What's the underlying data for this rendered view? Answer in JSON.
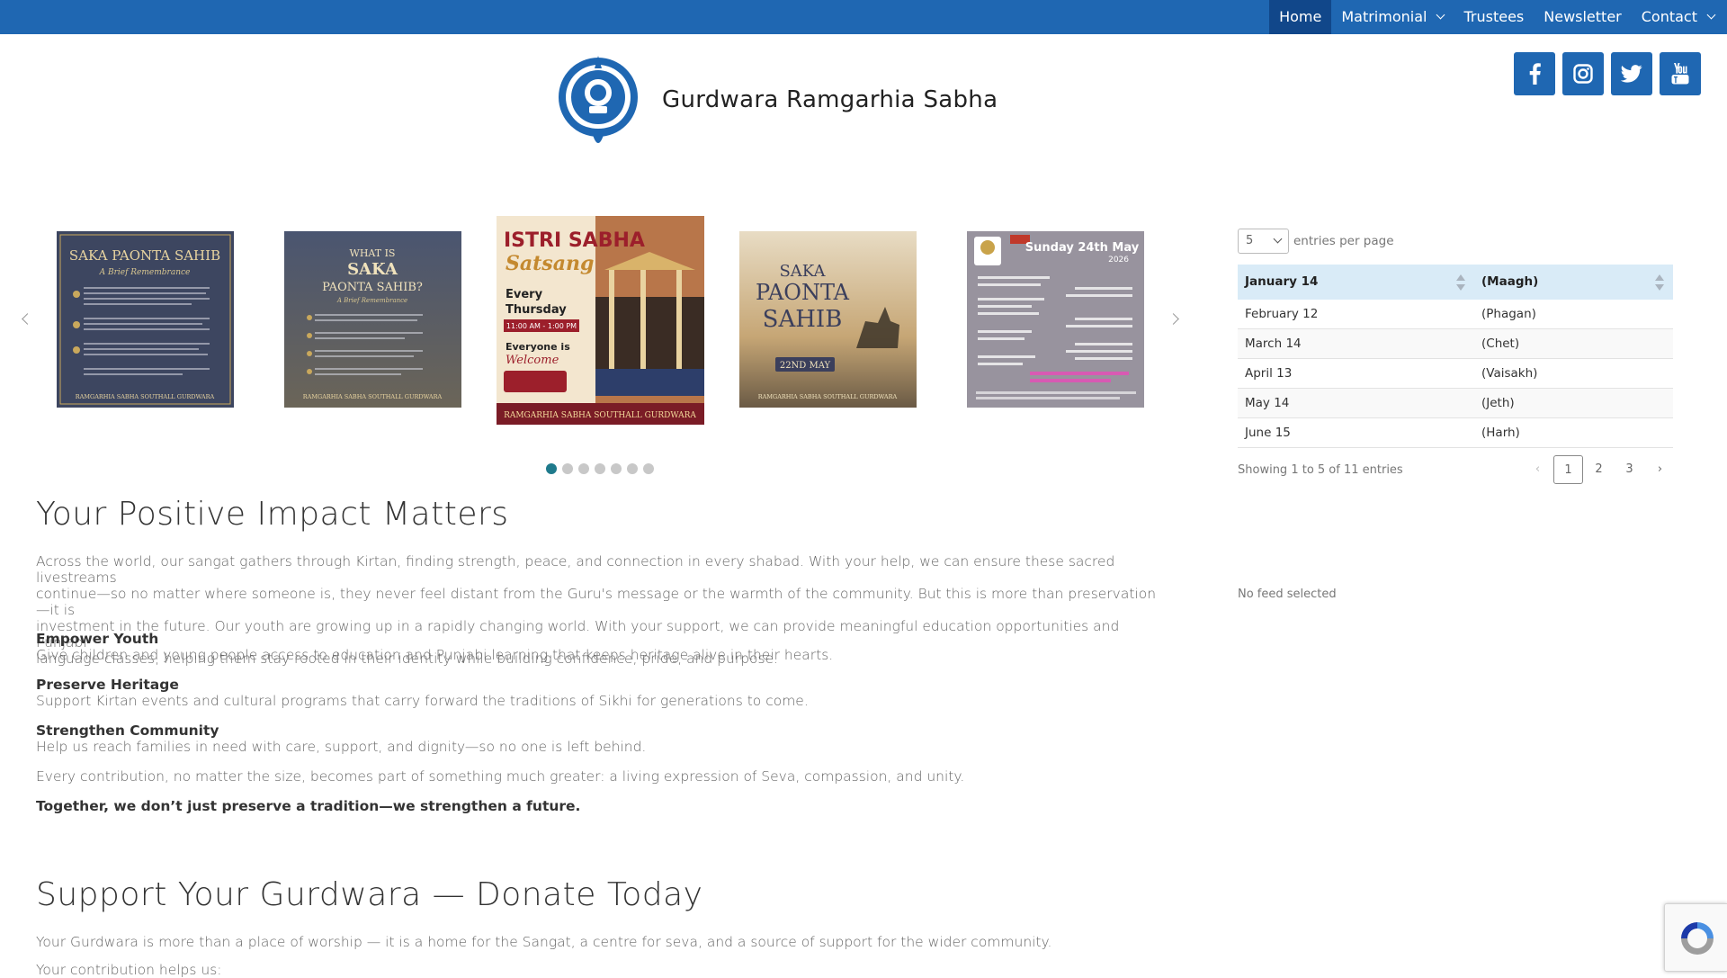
{
  "nav": {
    "items": [
      {
        "label": "Home",
        "active": true,
        "dropdown": false
      },
      {
        "label": "Matrimonial",
        "active": false,
        "dropdown": true
      },
      {
        "label": "Trustees",
        "active": false,
        "dropdown": false
      },
      {
        "label": "Newsletter",
        "active": false,
        "dropdown": false
      },
      {
        "label": "Contact",
        "active": false,
        "dropdown": true
      }
    ]
  },
  "header": {
    "site_title": "Gurdwara Ramgarhia Sabha",
    "social": [
      "facebook-icon",
      "instagram-icon",
      "twitter-icon",
      "youtube-icon"
    ]
  },
  "carousel": {
    "slides": [
      {
        "title_line1": "SAKA PAONTA SAHIB",
        "subtitle": "A Brief Remembrance",
        "footer": "RAMGARHIA SABHA SOUTHALL GURDWARA"
      },
      {
        "title_line1": "WHAT IS",
        "title_line2": "SAKA",
        "title_line3": "PAONTA SAHIB?",
        "subtitle": "A Brief Remembrance",
        "footer": "RAMGARHIA SABHA SOUTHALL GURDWARA"
      },
      {
        "title_line1": "ISTRI SABHA",
        "title_line2": "Satsang",
        "every": "Every",
        "day": "Thursday",
        "time": "11:00 AM - 1:00 PM",
        "welcome1": "Everyone is",
        "welcome2": "Welcome",
        "footer": "RAMGARHIA SABHA SOUTHALL GURDWARA"
      },
      {
        "title_line1": "SAKA",
        "title_line2": "PAONTA",
        "title_line3": "SAHIB",
        "date": "22ND MAY",
        "footer": "RAMGARHIA SABHA SOUTHALL GURDWARA"
      },
      {
        "title_line1": "Sunday 24th May",
        "title_line2": "2026"
      }
    ],
    "dots": 7,
    "active_dot": 0
  },
  "impact": {
    "heading": "Your Positive Impact Matters",
    "intro_l1": "Across the world, our sangat gathers through Kirtan, finding strength, peace, and connection in every shabad. With your help, we can ensure these sacred livestreams",
    "intro_l2": "continue—so no matter where someone is, they never feel distant from the Guru's message or the warmth of the community. But this is more than preservation—it is",
    "intro_l3": "investment in the future. Our youth are growing up in a rapidly changing world. With your support, we can provide meaningful education opportunities and Punjabi",
    "intro_l4": "language classes, helping them stay rooted in their identity while building confidence, pride, and purpose.",
    "items": [
      {
        "title": "Empower Youth",
        "text": "Give children and young people access to education and Punjabi learning that keeps heritage alive in their hearts."
      },
      {
        "title": "Preserve Heritage",
        "text": "Support Kirtan events and cultural programs that carry forward the traditions of Sikhi for generations to come."
      },
      {
        "title": "Strengthen Community",
        "text": "Help us reach families in need with care, support, and dignity—so no one is left behind."
      }
    ],
    "contribution": "Every contribution, no matter the size, becomes part of something much greater: a living expression of Seva, compassion, and unity.",
    "closing": "Together, we don’t just preserve a tradition—we strengthen a future."
  },
  "donate": {
    "heading": "Support Your Gurdwara — Donate Today",
    "text": "Your Gurdwara is more than a place of worship — it is a home for the Sangat, a centre for seva, and a source of support for the wider community.",
    "helps": "Your contribution helps us:"
  },
  "table": {
    "page_size": "5",
    "entries_label": "entries per page",
    "headers": [
      "January 14",
      "(Maagh)"
    ],
    "rows": [
      [
        "February 12",
        "(Phagan)"
      ],
      [
        "March 14",
        "(Chet)"
      ],
      [
        "April 13",
        "(Vaisakh)"
      ],
      [
        "May 14",
        "(Jeth)"
      ],
      [
        "June 15",
        "(Harh)"
      ]
    ],
    "info": "Showing 1 to 5 of 11 entries",
    "pagination": {
      "prev": "‹",
      "pages": [
        "1",
        "2",
        "3"
      ],
      "current": "1",
      "next": "›"
    }
  },
  "feed": {
    "status": "No feed selected"
  },
  "colors": {
    "brand": "#1f67b2",
    "active_nav": "#11478a",
    "table_header": "#d9ebf7",
    "active_dot": "#1f7a8c"
  }
}
